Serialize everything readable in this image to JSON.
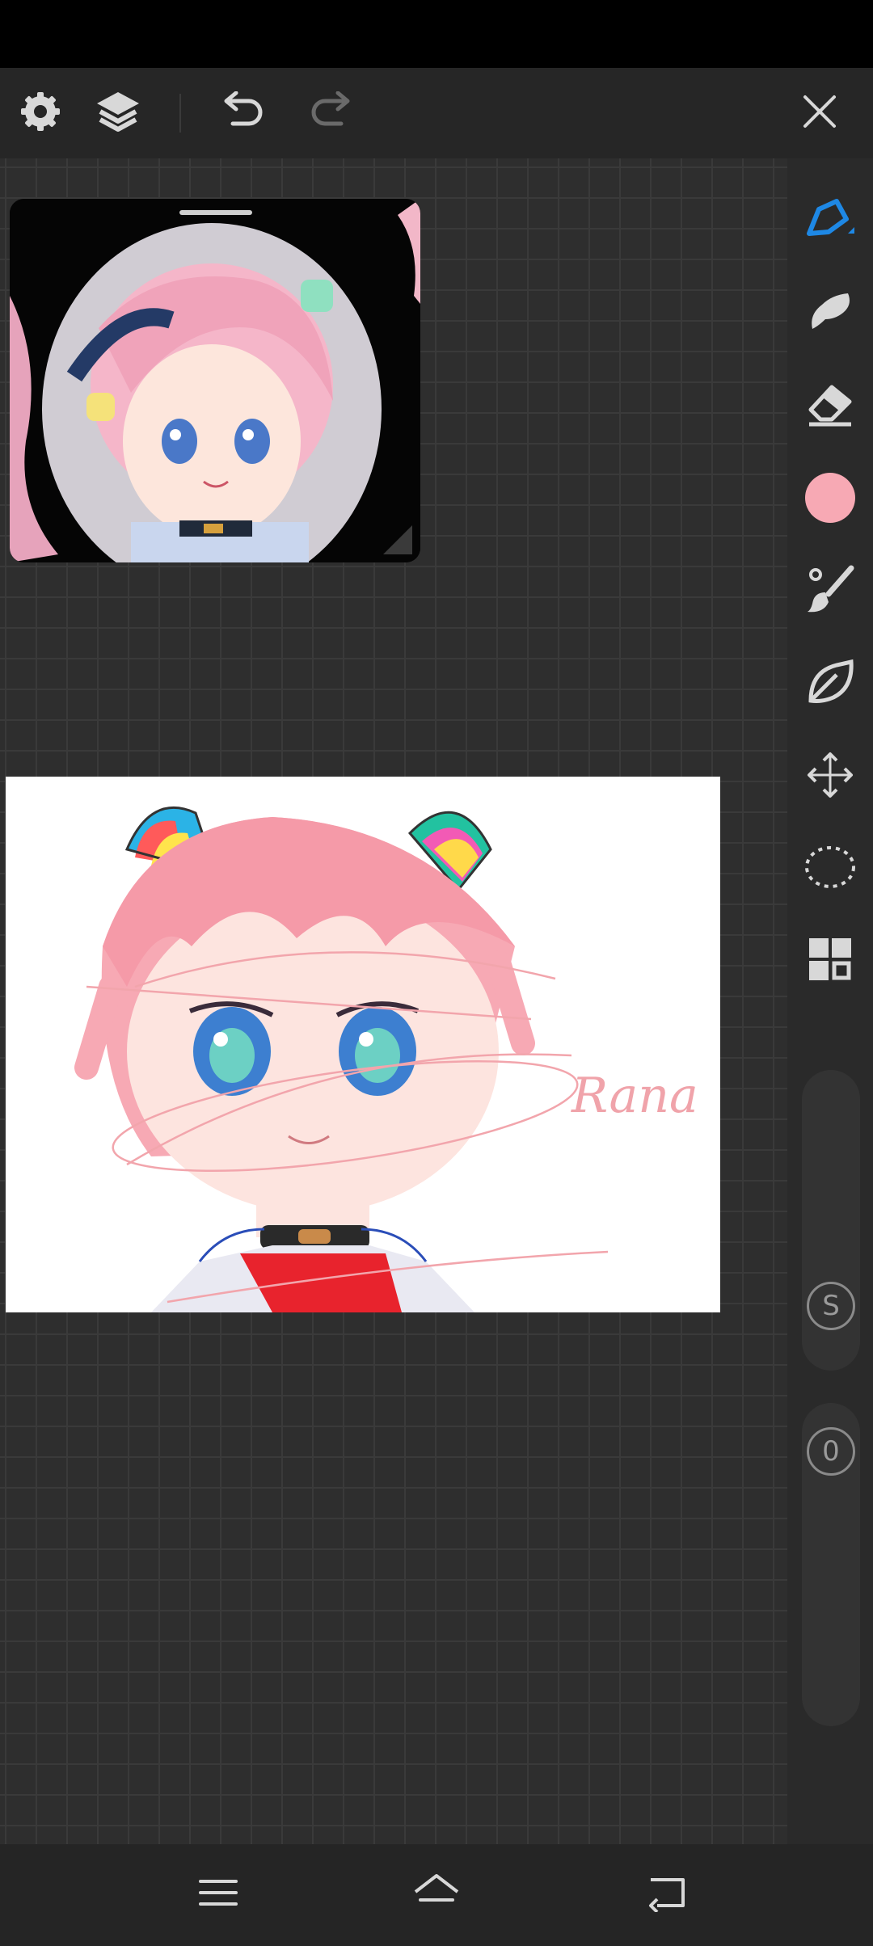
{
  "colors": {
    "accent": "#1e88e5",
    "current_color": "#f7a9b4",
    "icon": "#d8d8d8"
  },
  "toolbar": {
    "icons": [
      "gear-icon",
      "layers-icon",
      "undo-icon",
      "redo-icon",
      "close-icon"
    ]
  },
  "tools": [
    "pen-icon",
    "smudge-icon",
    "eraser-icon",
    "color-swatch",
    "brush-icon",
    "fill-icon",
    "transform-icon",
    "lasso-icon",
    "grid-icon"
  ],
  "sliders": {
    "size_label": "S",
    "opacity_label": "0"
  },
  "drawing": {
    "signature": "Rana"
  },
  "nav": {
    "icons": [
      "menu-icon",
      "home-icon",
      "back-icon"
    ]
  }
}
